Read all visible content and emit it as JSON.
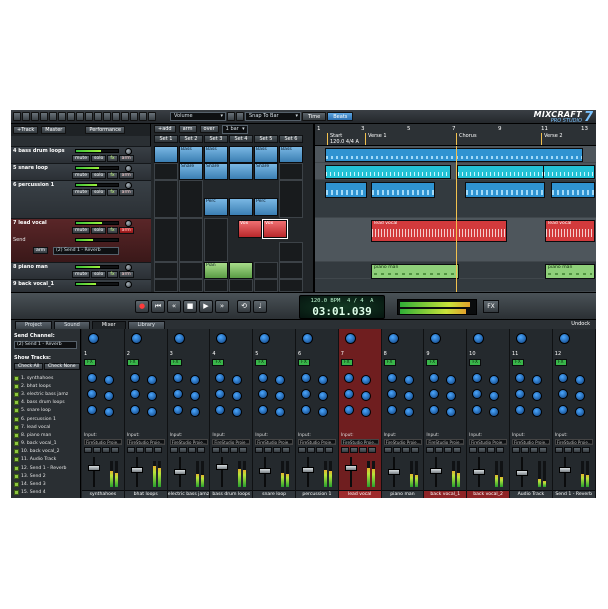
{
  "toolbar": {
    "view_dropdown": "Volume",
    "snap_dropdown": "Snap To Bar",
    "time_button": "Time",
    "beats_button": "Beats"
  },
  "logo": {
    "main": "MIXCRAFT",
    "sub": "PRO STUDIO",
    "num": "7"
  },
  "tracklist": {
    "add_track": "+Track",
    "master": "Master",
    "performance": "Performance",
    "tracks": [
      {
        "name": "4 bass drum loops",
        "mute": "mute",
        "solo": "solo",
        "fx": "fx",
        "arm": "arm"
      },
      {
        "name": "5 snare loop",
        "mute": "mute",
        "solo": "solo",
        "fx": "fx",
        "arm": "arm"
      },
      {
        "name": "6 percussion 1",
        "mute": "mute",
        "solo": "solo",
        "fx": "fx",
        "arm": "arm"
      },
      {
        "name": "7 lead vocal",
        "mute": "mute",
        "solo": "solo",
        "fx": "fx",
        "arm": "arm"
      },
      {
        "name": "8 piano man",
        "mute": "mute",
        "solo": "solo",
        "fx": "fx",
        "arm": "arm"
      },
      {
        "name": "9 back vocal_1",
        "mute": "mute",
        "solo": "solo",
        "fx": "fx",
        "arm": "arm"
      }
    ],
    "send_label": "Send",
    "send_arm": "arm",
    "send_dropdown": "(2) Send 1 - Reverb"
  },
  "perf": {
    "add": "+add",
    "arm": "arm",
    "over": "over",
    "bar_dd": "1 bar",
    "sets": [
      "Set 1",
      "Set 2",
      "Set 3",
      "Set 4",
      "Set 5",
      "Set 6"
    ],
    "clip_bass": "Bass",
    "clip_snare": "Snare",
    "clip_perc": "Perc",
    "clip_vox": "Vox",
    "clip_piano": "Pian"
  },
  "arrangement": {
    "ruler_numbers": [
      "1",
      "3",
      "5",
      "7",
      "9",
      "11",
      "13"
    ],
    "markers": [
      "Start",
      "Verse 1",
      "Chorus",
      "Verse 2"
    ],
    "tempo_marker": "120.0 4/4 A",
    "clip_vocal": "lead vocal",
    "clip_piano": "piano man"
  },
  "transport": {
    "bpm_display": "120.0 BPM",
    "sig_display": "4 / 4",
    "key_display": "A",
    "time_display": "03:01.039",
    "fx_button": "FX"
  },
  "tabs": [
    "Project",
    "Sound",
    "Mixer",
    "Library"
  ],
  "undock": "Undock",
  "mixer": {
    "send_channel_label": "Send Channel:",
    "send_channel_value": "(2) Send 1 - Reverb",
    "show_tracks_label": "Show Tracks:",
    "check_all": "Check All",
    "check_none": "Check None",
    "show_items": [
      "1. synthahoes",
      "2. bhat loops",
      "3. electric bass jamz",
      "4. bass drum loops",
      "5. snare loop",
      "6. percussion 1",
      "7. lead vocal",
      "8. piano man",
      "9. back vocal_1",
      "10. back vocal_2",
      "11. Audio Track",
      "12. Send 1 - Reverb",
      "13. Send 2",
      "14. Send 3",
      "15. Send 4"
    ],
    "strips": [
      "synthahoes",
      "bhat loops",
      "electric bass jamz",
      "bass drum loops",
      "snare loop",
      "percussion 1",
      "lead vocal",
      "piano man",
      "back vocal_1",
      "back vocal_2",
      "Audio Track",
      "Send 1 - Reverb"
    ],
    "input_label": "Input:",
    "input_value": "FireStudio Proje..."
  },
  "colors": {
    "accent_blue": "#2f93d1",
    "selected_red": "#d23a3c",
    "armed_red": "#b9282b",
    "fx_green": "#39b54a"
  }
}
